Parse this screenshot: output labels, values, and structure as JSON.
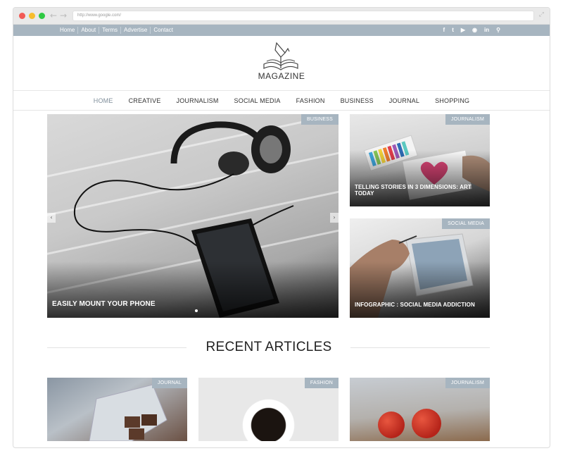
{
  "browser": {
    "url": "http://www.google.com/"
  },
  "topbar": {
    "links": [
      "Home",
      "About",
      "Terms",
      "Advertise",
      "Contact"
    ],
    "social_icons": [
      "facebook-icon",
      "twitter-icon",
      "youtube-icon",
      "flickr-icon",
      "linkedin-icon",
      "search-icon"
    ]
  },
  "logo": {
    "text": "MAGAZINE"
  },
  "mainnav": {
    "items": [
      "HOME",
      "CREATIVE",
      "JOURNALISM",
      "SOCIAL MEDIA",
      "FASHION",
      "BUSINESS",
      "JOURNAL",
      "SHOPPING"
    ],
    "active": "HOME"
  },
  "featured": {
    "main": {
      "tag": "BUSINESS",
      "title": "EASILY MOUNT YOUR PHONE"
    },
    "side1": {
      "tag": "JOURNALISM",
      "title": "TELLING STORIES IN 3 DIMENSIONS: ART TODAY"
    },
    "side2": {
      "tag": "SOCIAL MEDIA",
      "title": "INFOGRAPHIC : SOCIAL MEDIA ADDICTION"
    }
  },
  "recent": {
    "heading": "RECENT ARTICLES",
    "cards": [
      {
        "tag": "JOURNAL"
      },
      {
        "tag": "FASHION"
      },
      {
        "tag": "JOURNALISM"
      }
    ]
  },
  "colors": {
    "accent": "#a7b5c0",
    "active_nav": "#7f8e9a"
  }
}
